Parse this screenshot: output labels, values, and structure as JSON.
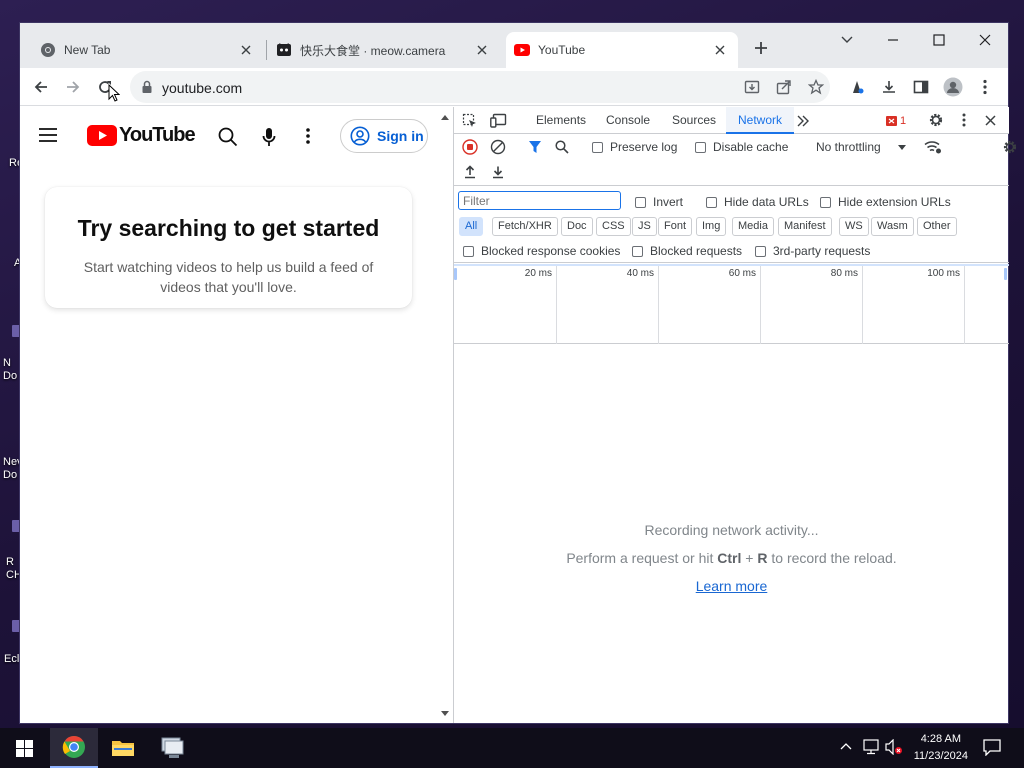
{
  "browser": {
    "tabs": [
      {
        "title": "New Tab",
        "active": false
      },
      {
        "title": "快乐大食堂 · meow.camera",
        "active": false
      },
      {
        "title": "YouTube",
        "active": true
      }
    ],
    "address": "youtube.com"
  },
  "youtube": {
    "logo_text": "YouTube",
    "sign_in": "Sign in",
    "card_title": "Try searching to get started",
    "card_text": "Start watching videos to help us build a feed of videos that you'll love."
  },
  "devtools": {
    "panels": [
      "Elements",
      "Console",
      "Sources",
      "Network"
    ],
    "active_panel": "Network",
    "issues_count": "1",
    "preserve_log": "Preserve log",
    "disable_cache": "Disable cache",
    "throttling": "No throttling",
    "filter_placeholder": "Filter",
    "invert": "Invert",
    "hide_data_urls": "Hide data URLs",
    "hide_extension_urls": "Hide extension URLs",
    "type_filters": [
      "All",
      "Fetch/XHR",
      "Doc",
      "CSS",
      "JS",
      "Font",
      "Img",
      "Media",
      "Manifest",
      "WS",
      "Wasm",
      "Other"
    ],
    "blocked_cookies": "Blocked response cookies",
    "blocked_requests": "Blocked requests",
    "third_party": "3rd-party requests",
    "timeline_ticks": [
      "20 ms",
      "40 ms",
      "60 ms",
      "80 ms",
      "100 ms"
    ],
    "recording": "Recording network activity...",
    "hint_pre": "Perform a request or hit ",
    "hint_key1": "Ctrl",
    "hint_plus": " + ",
    "hint_key2": "R",
    "hint_post": " to record the reload.",
    "learn_more": "Learn more"
  },
  "desktop": {
    "icon_labels": [
      "Re",
      "A",
      "N Do",
      "Nev Do",
      "R CH",
      "Ecl"
    ]
  },
  "taskbar": {
    "time": "4:28 AM",
    "date": "11/23/2024"
  },
  "colors": {
    "accent": "#1a73e8",
    "youtube_red": "#ff0000",
    "record_red": "#d93025"
  }
}
